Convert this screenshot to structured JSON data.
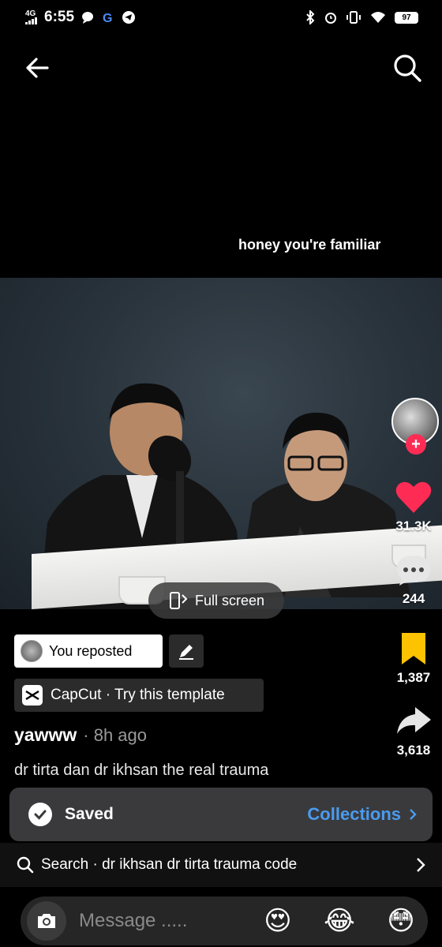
{
  "status_bar": {
    "network": "4G",
    "time": "6:55",
    "battery": "97"
  },
  "video": {
    "caption": "honey you're familiar",
    "fullscreen_label": "Full screen"
  },
  "actions": {
    "likes": "31.3K",
    "comments": "244",
    "saves": "1,387",
    "shares": "3,618",
    "like_color": "#fe2c55",
    "save_color": "#fdc300"
  },
  "repost": {
    "label": "You reposted"
  },
  "template": {
    "label": "CapCut · Try this template"
  },
  "post": {
    "author": "yawww",
    "time": "· 8h ago",
    "description": "dr tirta dan dr ikhsan the real trauma"
  },
  "toast": {
    "label": "Saved",
    "action": "Collections"
  },
  "search": {
    "label": "Search · dr ikhsan dr tirta trauma code"
  },
  "message": {
    "placeholder": "Message .....",
    "emojis": [
      "😍",
      "😂",
      "😳"
    ]
  }
}
